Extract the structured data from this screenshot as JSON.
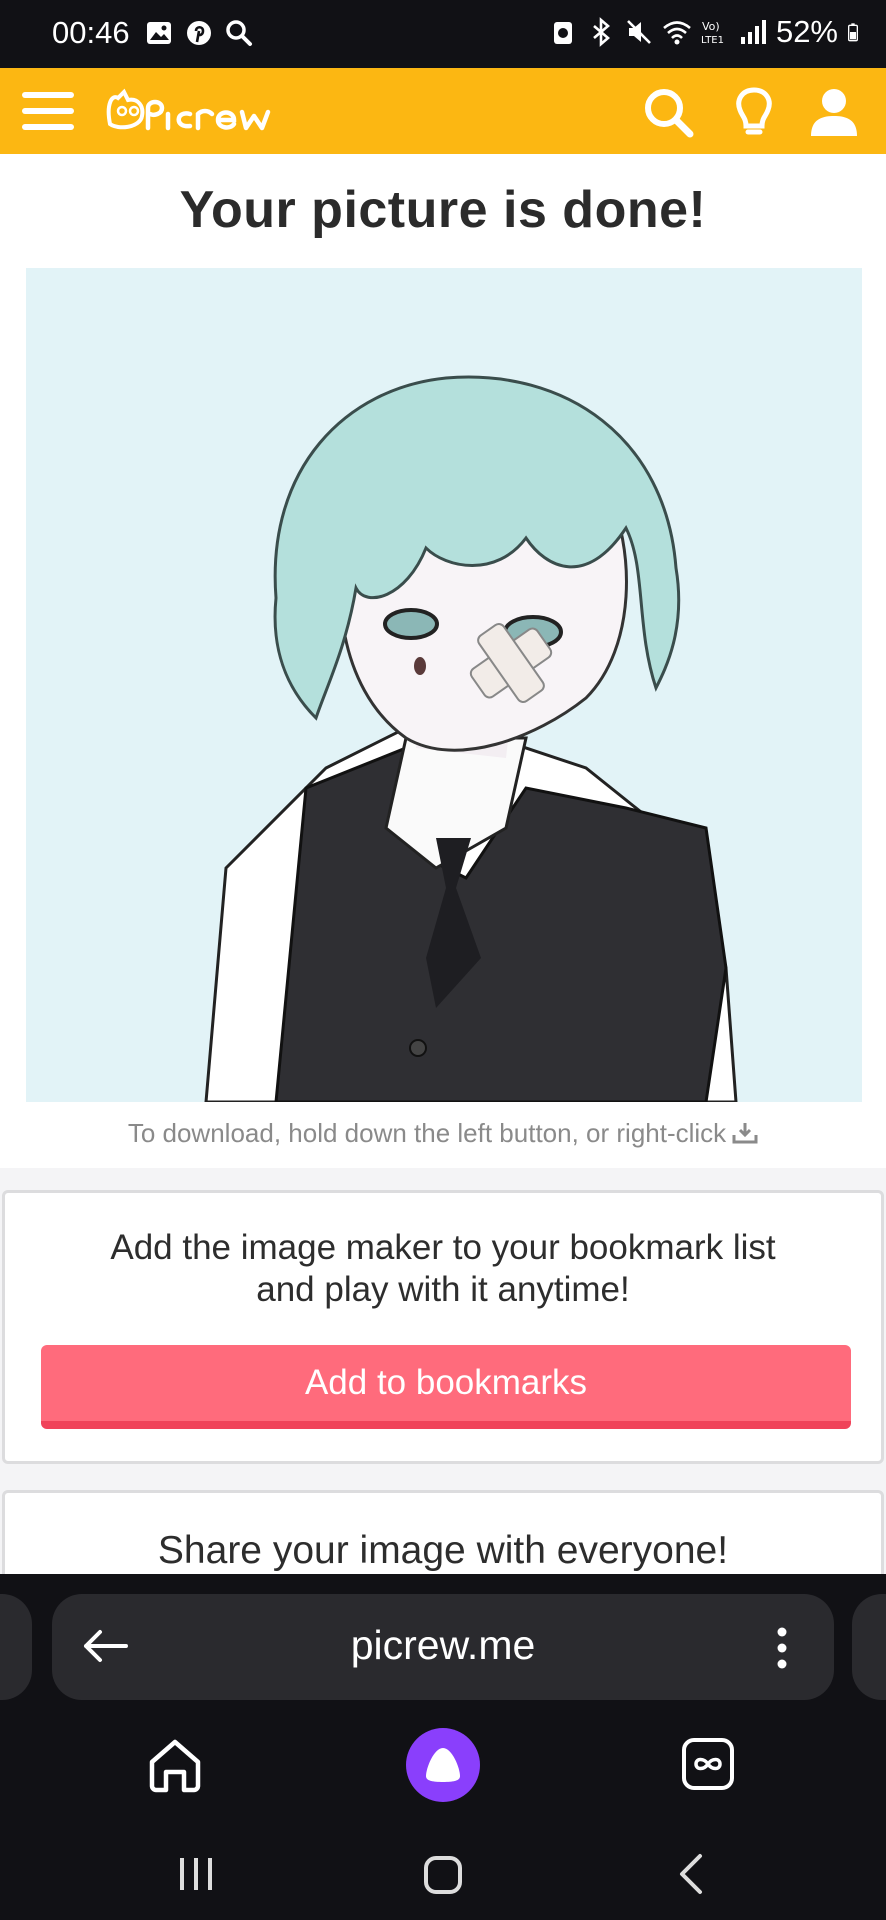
{
  "status_bar": {
    "time": "00:46",
    "battery": "52%",
    "left_icons": [
      "gallery-icon",
      "pinterest-icon",
      "search-icon"
    ],
    "right_icons": [
      "vpn-icon",
      "bluetooth-icon",
      "mute-icon",
      "wifi-icon",
      "volte-icon",
      "signal-icon",
      "battery-icon"
    ]
  },
  "header": {
    "logo_text": "Picrew",
    "accent_color": "#fcb712",
    "icons": [
      "menu-icon",
      "search-icon",
      "lightbulb-icon",
      "user-icon"
    ]
  },
  "result": {
    "title": "Your picture is done!",
    "download_hint": "To download, hold down the left button, or right-click"
  },
  "bookmark": {
    "text_line1": "Add the image maker to your bookmark list",
    "text_line2": "and play with it anytime!",
    "button_label": "Add to bookmarks",
    "button_color": "#ff6b7c"
  },
  "share": {
    "text": "Share your image with everyone!"
  },
  "browser": {
    "url": "picrew.me",
    "icons": [
      "back-arrow-icon",
      "more-icon",
      "home-icon",
      "alice-icon",
      "tabs-icon"
    ]
  },
  "system_nav": {
    "icons": [
      "recent-apps-icon",
      "home-button-icon",
      "back-icon"
    ]
  }
}
